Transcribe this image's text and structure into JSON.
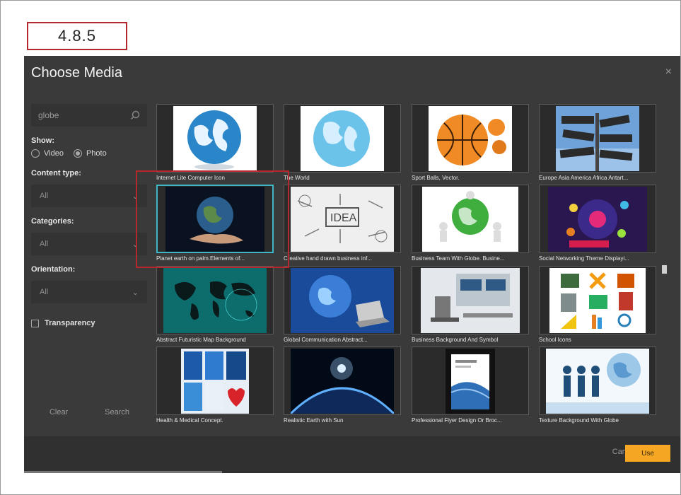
{
  "step": "4.8.5",
  "dialog": {
    "title": "Choose Media",
    "close": "×"
  },
  "sidebar": {
    "search_value": "globe",
    "show_label": "Show:",
    "video_label": "Video",
    "photo_label": "Photo",
    "content_type_label": "Content type:",
    "content_type_value": "All",
    "categories_label": "Categories:",
    "categories_value": "All",
    "orientation_label": "Orientation:",
    "orientation_value": "All",
    "transparency_label": "Transparency",
    "clear_label": "Clear",
    "search_label": "Search"
  },
  "grid": {
    "items": [
      {
        "caption": "Internet Lite Computer Icon",
        "icon": "globe-icon"
      },
      {
        "caption": "The World",
        "icon": "globe-icon"
      },
      {
        "caption": "Sport Balls, Vector.",
        "icon": "basketball-icon"
      },
      {
        "caption": "Europe Asia America Africa Antart...",
        "icon": "signpost-icon"
      },
      {
        "caption": "Planet earth on palm.Elements of...",
        "icon": "earth-palm-icon"
      },
      {
        "caption": "Creative hand drawn business inf...",
        "icon": "idea-sketch-icon"
      },
      {
        "caption": "Business Team With Globe. Busine...",
        "icon": "team-globe-icon"
      },
      {
        "caption": "Social Networking Theme Displayi...",
        "icon": "social-media-icon"
      },
      {
        "caption": "Abstract Futuristic Map Background",
        "icon": "world-map-icon"
      },
      {
        "caption": "Global Communication Abstract...",
        "icon": "laptop-globe-icon"
      },
      {
        "caption": "Business Background And Symbol",
        "icon": "office-icon"
      },
      {
        "caption": "School Icons",
        "icon": "school-icons-icon"
      },
      {
        "caption": "Health & Medical Concept.",
        "icon": "medical-icon"
      },
      {
        "caption": "Realistic Earth with Sun",
        "icon": "earth-sun-icon"
      },
      {
        "caption": "Professional Flyer Design Or Broc...",
        "icon": "flyer-icon"
      },
      {
        "caption": "Texture Background With Globe",
        "icon": "business-people-icon"
      }
    ],
    "selected_index": 4
  },
  "footer": {
    "cancel_label": "Cancel",
    "use_label": "Use"
  },
  "colors": {
    "dialog_bg": "#3a3a3a",
    "accent": "#f5a623",
    "selection": "#3fb6c8",
    "highlight": "#b3272d"
  }
}
